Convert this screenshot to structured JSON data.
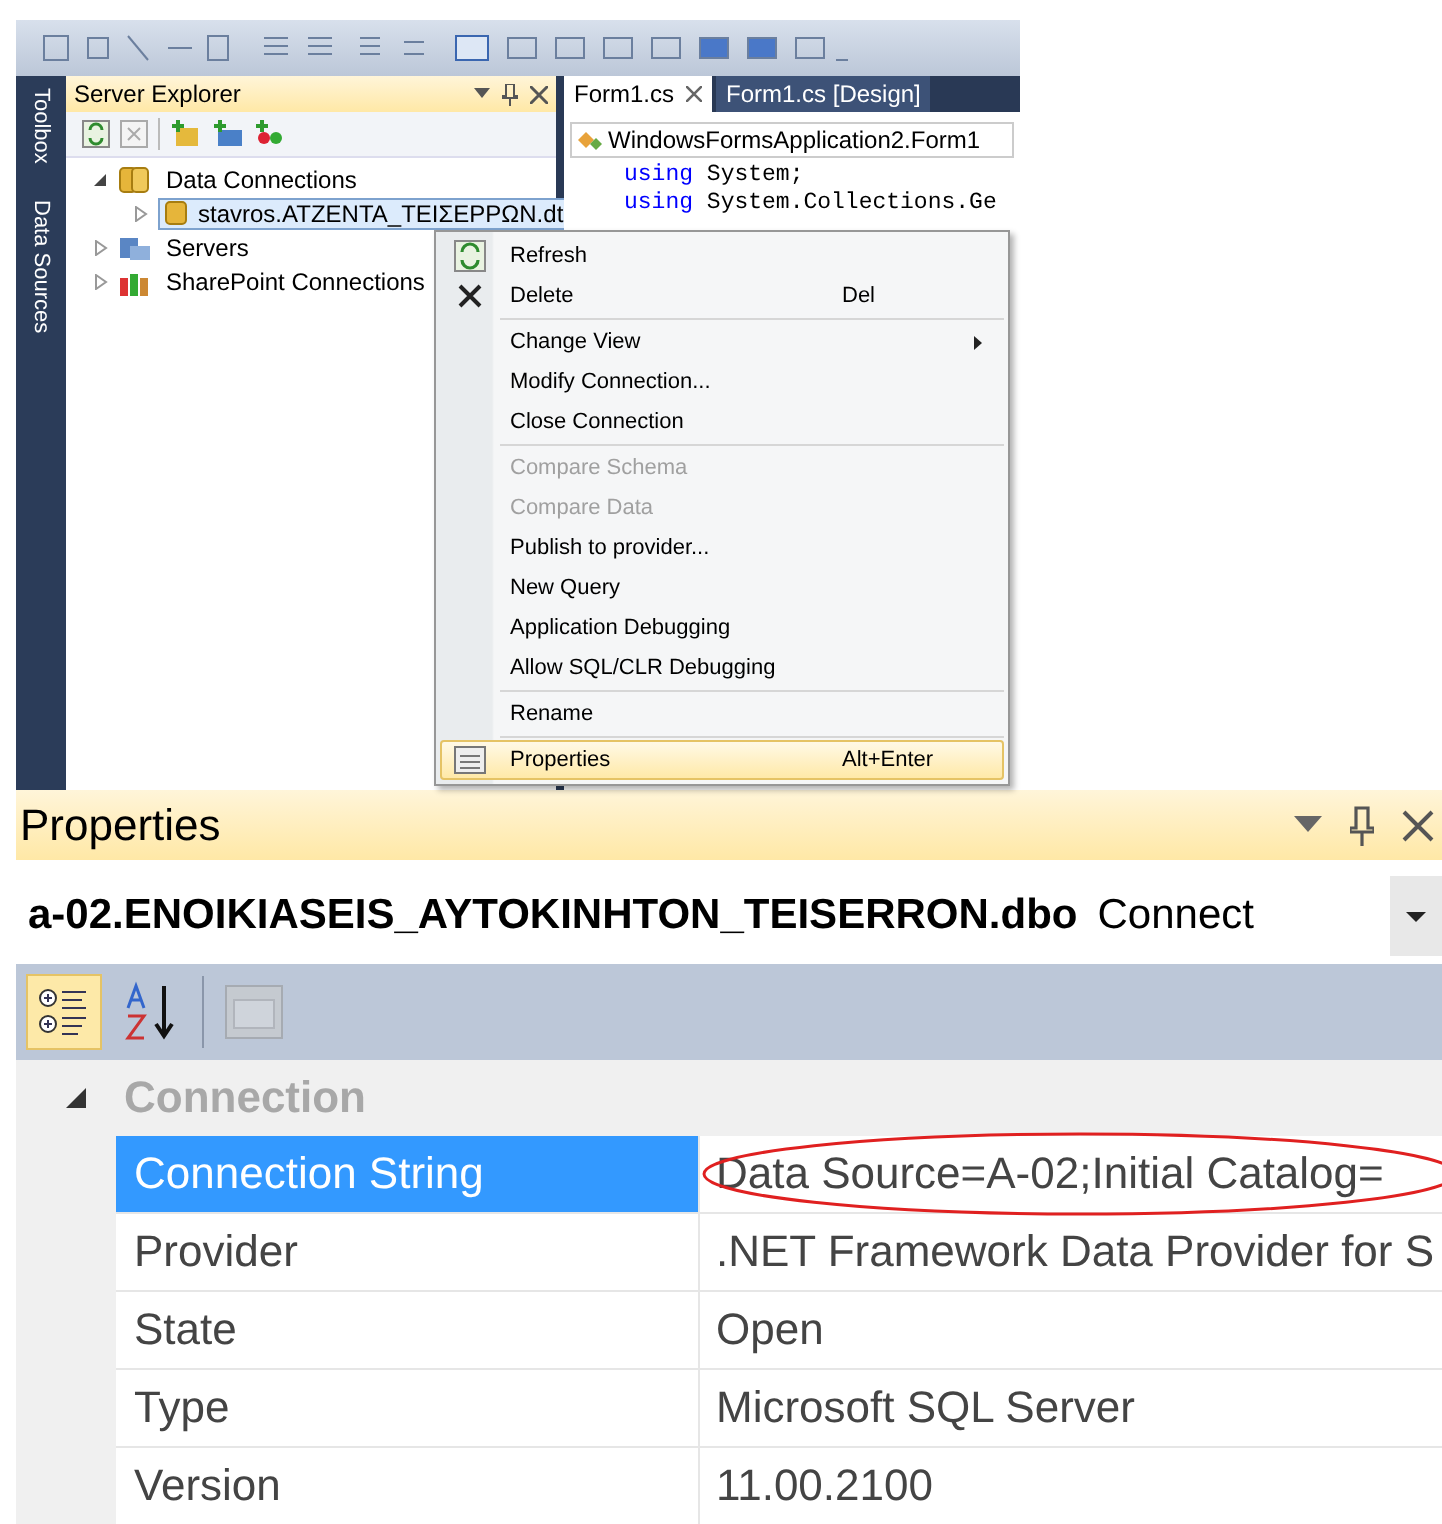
{
  "side_strip": {
    "tabs": [
      "Toolbox",
      "Data Sources"
    ]
  },
  "server_explorer": {
    "title": "Server Explorer",
    "tree": [
      {
        "label": "Data Connections",
        "expanded": true,
        "selected": false,
        "children": [
          {
            "label": "stavros.ATZENTA_ΤΕΙΣΕΡΡΩΝ.dt",
            "expanded": false,
            "selected": true
          }
        ]
      },
      {
        "label": "Servers",
        "expanded": false,
        "selected": false
      },
      {
        "label": "SharePoint Connections",
        "expanded": false,
        "selected": false
      }
    ]
  },
  "editor": {
    "tabs": [
      {
        "label": "Form1.cs",
        "selected": true
      },
      {
        "label": "Form1.cs [Design]",
        "selected": false
      }
    ],
    "class_dropdown": "WindowsFormsApplication2.Form1",
    "code_lines": [
      {
        "keyword": "using",
        "text": "System;"
      },
      {
        "keyword": "using",
        "text": "System.Collections.Ge"
      }
    ]
  },
  "context_menu": [
    {
      "kind": "item",
      "label": "Refresh",
      "disabled": false,
      "selected": false
    },
    {
      "kind": "item",
      "label": "Delete",
      "shortcut": "Del",
      "disabled": false,
      "selected": false
    },
    {
      "kind": "separator"
    },
    {
      "kind": "item",
      "label": "Change View",
      "submenu": true,
      "disabled": false,
      "selected": false
    },
    {
      "kind": "item",
      "label": "Modify Connection...",
      "disabled": false,
      "selected": false
    },
    {
      "kind": "item",
      "label": "Close Connection",
      "disabled": false,
      "selected": false
    },
    {
      "kind": "separator"
    },
    {
      "kind": "item",
      "label": "Compare Schema",
      "disabled": true,
      "selected": false
    },
    {
      "kind": "item",
      "label": "Compare Data",
      "disabled": true,
      "selected": false
    },
    {
      "kind": "item",
      "label": "Publish to provider...",
      "disabled": false,
      "selected": false
    },
    {
      "kind": "item",
      "label": "New Query",
      "disabled": false,
      "selected": false
    },
    {
      "kind": "item",
      "label": "Application Debugging",
      "disabled": false,
      "selected": false
    },
    {
      "kind": "item",
      "label": "Allow SQL/CLR Debugging",
      "disabled": false,
      "selected": false
    },
    {
      "kind": "separator"
    },
    {
      "kind": "item",
      "label": "Rename",
      "disabled": false,
      "selected": false
    },
    {
      "kind": "separator"
    },
    {
      "kind": "item",
      "label": "Properties",
      "shortcut": "Alt+Enter",
      "disabled": false,
      "selected": true
    }
  ],
  "properties": {
    "title": "Properties",
    "object_name": "a-02.ENOIKIASEIS_AYTOKINHTON_TEISERRON.dbo",
    "object_type": "Connect",
    "toolbar": [
      {
        "kind": "categorized",
        "selected": true,
        "disabled": false
      },
      {
        "kind": "alphabetical",
        "selected": false,
        "disabled": false
      },
      {
        "kind": "pages",
        "selected": false,
        "disabled": true
      }
    ],
    "category": {
      "label": "Connection",
      "expanded": true
    },
    "rows": [
      {
        "name": "Connection String",
        "value": "Data Source=A-02;Initial Catalog=",
        "selected": true,
        "circled": true
      },
      {
        "name": "Provider",
        "value": ".NET Framework Data Provider for S",
        "selected": false,
        "circled": false
      },
      {
        "name": "State",
        "value": "Open",
        "selected": false,
        "circled": false
      },
      {
        "name": "Type",
        "value": "Microsoft SQL Server",
        "selected": false,
        "circled": false
      },
      {
        "name": "Version",
        "value": "11.00.2100",
        "selected": false,
        "circled": false
      }
    ]
  }
}
